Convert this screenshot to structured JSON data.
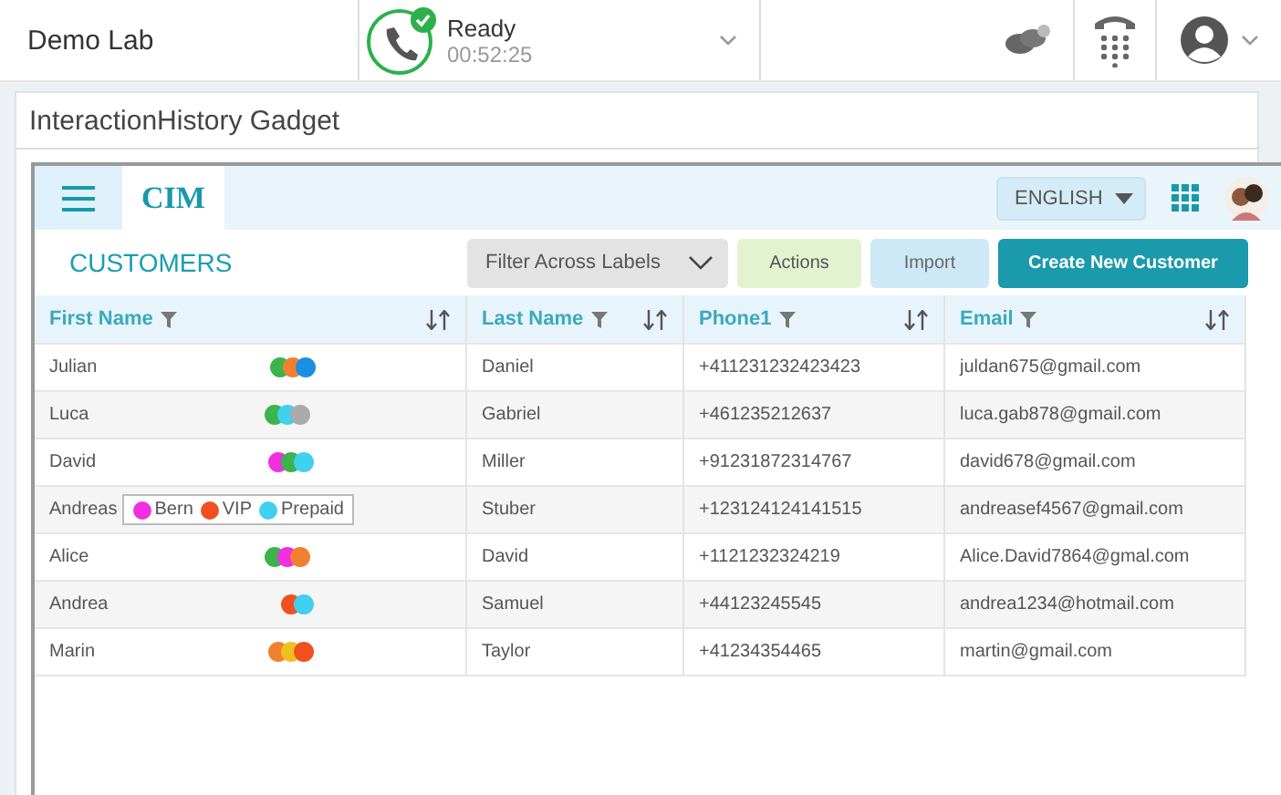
{
  "topbar": {
    "title": "Demo Lab",
    "status": "Ready",
    "timer": "00:52:25"
  },
  "gadget": {
    "title": "InteractionHistory Gadget"
  },
  "cim": {
    "logo": "CIM",
    "language": "ENGLISH",
    "heading": "CUSTOMERS",
    "filter_placeholder": "Filter Across Labels",
    "buttons": [
      "Actions",
      "Import",
      "Create New Customer"
    ]
  },
  "table": {
    "columns": [
      "First Name",
      "Last Name",
      "Phone1",
      "Email"
    ],
    "rows": [
      {
        "first": "Julian",
        "last": "Daniel",
        "phone": "+411231232423423",
        "email": "juldan675@gmail.com",
        "labels_expanded": false,
        "labels": [
          {
            "color": "#3cb44b"
          },
          {
            "color": "#f08030"
          },
          {
            "color": "#1a8ee0"
          }
        ]
      },
      {
        "first": "Luca",
        "last": "Gabriel",
        "phone": "+461235212637",
        "email": "luca.gab878@gmail.com",
        "labels_expanded": false,
        "labels": [
          {
            "color": "#3cb44b"
          },
          {
            "color": "#40d0f0"
          },
          {
            "color": "#aaaaaa"
          }
        ]
      },
      {
        "first": "David",
        "last": "Miller",
        "phone": "+91231872314767",
        "email": "david678@gmail.com",
        "labels_expanded": false,
        "labels": [
          {
            "color": "#f030e0"
          },
          {
            "color": "#3cb44b"
          },
          {
            "color": "#40d0f0"
          }
        ]
      },
      {
        "first": "Andreas",
        "last": "Stuber",
        "phone": "+123124124141515",
        "email": "andreasef4567@gmail.com",
        "labels_expanded": true,
        "labels": [
          {
            "color": "#f030e0",
            "name": "Bern"
          },
          {
            "color": "#f05020",
            "name": "VIP"
          },
          {
            "color": "#40d0f0",
            "name": "Prepaid"
          }
        ]
      },
      {
        "first": "Alice",
        "last": "David",
        "phone": "+1121232324219",
        "email": "Alice.David7864@gmal.com",
        "labels_expanded": false,
        "labels": [
          {
            "color": "#3cb44b"
          },
          {
            "color": "#f030e0"
          },
          {
            "color": "#f08030"
          }
        ]
      },
      {
        "first": "Andrea",
        "last": "Samuel",
        "phone": "+44123245545",
        "email": "andrea1234@hotmail.com",
        "labels_expanded": false,
        "labels": [
          {
            "color": "#f05020"
          },
          {
            "color": "#40d0f0"
          }
        ]
      },
      {
        "first": "Marin",
        "last": "Taylor",
        "phone": "+41234354465",
        "email": "martin@gmail.com",
        "labels_expanded": false,
        "labels": [
          {
            "color": "#f08030"
          },
          {
            "color": "#f0c020"
          },
          {
            "color": "#f05020"
          }
        ]
      }
    ]
  }
}
